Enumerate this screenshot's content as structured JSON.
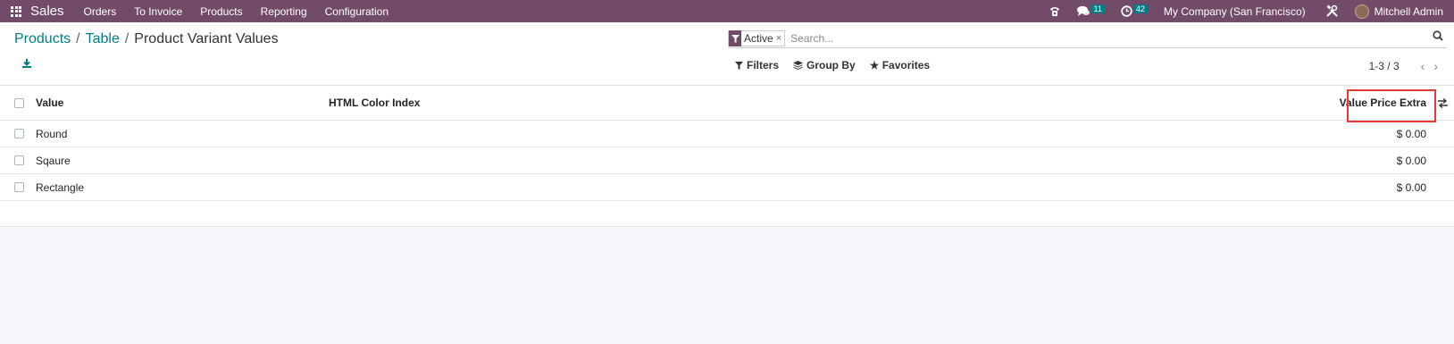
{
  "navbar": {
    "app_name": "Sales",
    "menu": [
      "Orders",
      "To Invoice",
      "Products",
      "Reporting",
      "Configuration"
    ],
    "messages_count": "11",
    "activities_count": "42",
    "company": "My Company (San Francisco)",
    "user": "Mitchell Admin"
  },
  "breadcrumb": {
    "items": [
      "Products",
      "Table"
    ],
    "current": "Product Variant Values"
  },
  "search": {
    "facet_label": "Active",
    "facet_remove": "×",
    "placeholder": "Search..."
  },
  "filters": {
    "filters_label": "Filters",
    "group_by_label": "Group By",
    "favorites_label": "Favorites"
  },
  "pager": {
    "value": "1-3 / 3",
    "prev": "‹",
    "next": "›"
  },
  "table": {
    "columns": [
      "Value",
      "HTML Color Index",
      "Value Price Extra"
    ],
    "rows": [
      {
        "value": "Round",
        "color": "",
        "price": "$ 0.00"
      },
      {
        "value": "Sqaure",
        "color": "",
        "price": "$ 0.00"
      },
      {
        "value": "Rectangle",
        "color": "",
        "price": "$ 0.00"
      }
    ]
  },
  "colors": {
    "brand": "#714b67",
    "accent": "#017e84",
    "highlight": "#e53935"
  }
}
